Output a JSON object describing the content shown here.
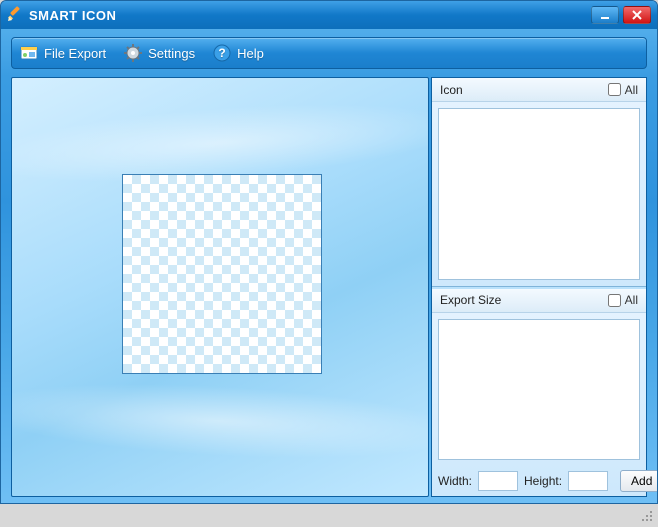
{
  "app": {
    "title": "SMART ICON"
  },
  "toolbar": {
    "file_export": "File Export",
    "settings": "Settings",
    "help": "Help"
  },
  "panels": {
    "icon": {
      "title": "Icon",
      "all_label": "All",
      "all_checked": false
    },
    "export_size": {
      "title": "Export Size",
      "all_label": "All",
      "all_checked": false
    }
  },
  "bottom": {
    "width_label": "Width:",
    "height_label": "Height:",
    "width_value": "",
    "height_value": "",
    "add_label": "Add"
  }
}
